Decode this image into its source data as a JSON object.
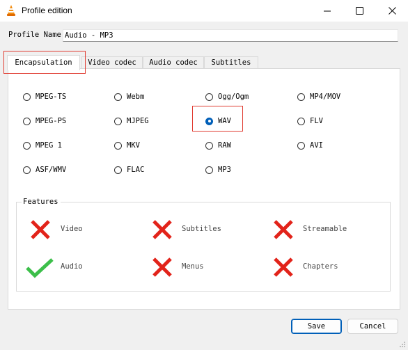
{
  "window": {
    "title": "Profile edition"
  },
  "profile_name": {
    "label": "Profile Name",
    "value": "Audio - MP3"
  },
  "tabs": [
    {
      "label": "Encapsulation",
      "active": true
    },
    {
      "label": "Video codec"
    },
    {
      "label": "Audio codec"
    },
    {
      "label": "Subtitles"
    }
  ],
  "encapsulation": {
    "options": [
      "MPEG-TS",
      "Webm",
      "Ogg/Ogm",
      "MP4/MOV",
      "MPEG-PS",
      "MJPEG",
      "WAV",
      "FLV",
      "MPEG 1",
      "MKV",
      "RAW",
      "AVI",
      "ASF/WMV",
      "FLAC",
      "MP3"
    ],
    "selected": "WAV"
  },
  "features": {
    "label": "Features",
    "items": [
      {
        "label": "Video",
        "supported": false
      },
      {
        "label": "Subtitles",
        "supported": false
      },
      {
        "label": "Streamable",
        "supported": false
      },
      {
        "label": "Audio",
        "supported": true
      },
      {
        "label": "Menus",
        "supported": false
      },
      {
        "label": "Chapters",
        "supported": false
      }
    ]
  },
  "buttons": {
    "save": "Save",
    "cancel": "Cancel"
  },
  "colors": {
    "accent": "#005fb8",
    "highlight": "#e03c31",
    "check": "#3cbf4a",
    "cross": "#e2231a"
  }
}
